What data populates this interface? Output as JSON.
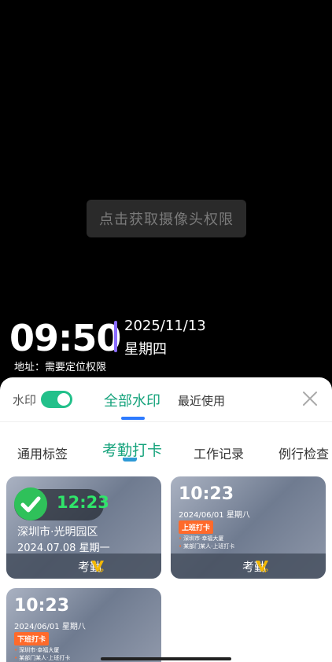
{
  "camera": {
    "permission_button": "点击获取摄像头权限"
  },
  "overlay": {
    "time": "09:50",
    "date": "2025/11/13",
    "weekday": "星期四",
    "address": "地址：需要定位权限"
  },
  "sheet": {
    "toggle_label": "水印",
    "toggle_on": true,
    "tabs": [
      "全部水印",
      "最近使用"
    ],
    "subtabs": [
      "通用标签",
      "考勤打卡",
      "工作记录",
      "例行检查"
    ],
    "active_subtab": "考勤打卡"
  },
  "cards": [
    {
      "time": "12:23",
      "location": "深圳市·光明园区",
      "date": "2024.07.08  星期一",
      "footer": "考勤"
    },
    {
      "time": "10:23",
      "date": "2024/06/01  星期八",
      "tag": "上班打卡",
      "lines": [
        "深圳市·幸福大厦",
        "某部门某人·上班打卡"
      ],
      "footer": "考勤"
    },
    {
      "time": "10:23",
      "date": "2024/06/01  星期八",
      "tag": "下班打卡",
      "lines": [
        "深圳市·幸福大厦",
        "某部门某人·上班打卡"
      ]
    }
  ],
  "colors": {
    "accent_green": "#16a37c",
    "toggle_green": "#22c08a",
    "tab_blue": "#2e7bff",
    "tag_orange": "#ff6a2b",
    "vip_gold": "#f2b705"
  }
}
